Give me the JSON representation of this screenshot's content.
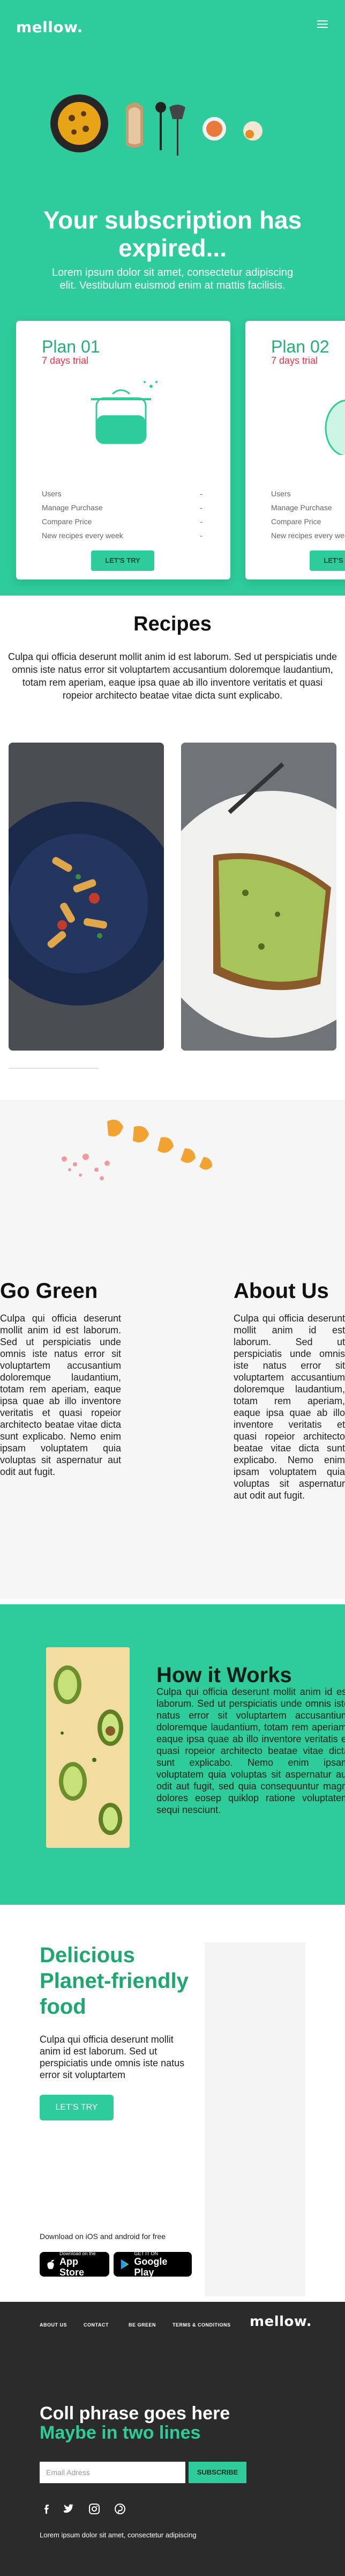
{
  "header": {
    "logo": "mellow."
  },
  "hero": {
    "title": "Your subscription has expired...",
    "subtitle": "Lorem ipsum dolor sit amet, consectetur adipiscing elit. Vestibulum euismod enim at mattis facilisis."
  },
  "plans": [
    {
      "title": "Plan 01",
      "trial": "7 days trial",
      "features": [
        {
          "label": "Users",
          "value": "-"
        },
        {
          "label": "Manage Purchase",
          "value": "-"
        },
        {
          "label": "Compare Price",
          "value": "-"
        },
        {
          "label": "New recipes every week",
          "value": "-"
        }
      ],
      "button": "LET'S TRY"
    },
    {
      "title": "Plan 02",
      "trial": "7 days trial",
      "features": [
        {
          "label": "Users",
          "value": ""
        },
        {
          "label": "Manage Purchase",
          "value": ""
        },
        {
          "label": "Compare Price",
          "value": ""
        },
        {
          "label": "New recipes every week",
          "value": ""
        }
      ],
      "button": "LET'S TRY"
    }
  ],
  "recipes": {
    "title": "Recipes",
    "text": "Culpa qui officia deserunt mollit anim id est laborum. Sed ut perspiciatis unde omnis iste natus error sit voluptartem accusantium doloremque laudantium, totam rem aperiam, eaque ipsa quae ab illo inventore veritatis et quasi ropeior architecto beatae vitae dicta sunt explicabo."
  },
  "go_green": {
    "title": "Go Green",
    "text": "Culpa qui officia deserunt mollit anim id est laborum. Sed ut perspiciatis unde omnis iste natus error sit voluptartem accusantium doloremque laudantium, totam rem aperiam, eaque ipsa quae ab illo inventore veritatis et quasi ropeior architecto beatae vitae dicta sunt explicabo. Nemo enim ipsam voluptatem quia voluptas sit aspernatur aut odit aut fugit."
  },
  "about": {
    "title": "About Us",
    "text": "Culpa qui officia deserunt mollit anim id est laborum. Sed ut perspiciatis unde omnis iste natus error sit voluptartem accusantium doloremque laudantium, totam rem aperiam, eaque ipsa quae ab illo inventore veritatis et quasi ropeior architecto beatae vitae dicta sunt explicabo. Nemo enim ipsam voluptatem quia voluptas sit aspernatur aut odit aut fugit."
  },
  "how": {
    "title": "How it Works",
    "text": "Culpa qui officia deserunt mollit anim id est laborum. Sed ut perspiciatis unde omnis iste natus error sit voluptartem accusantium doloremque laudantium, totam rem aperiam, eaque ipsa quae ab illo inventore veritatis et quasi ropeior architecto beatae vitae dicta sunt explicabo. Nemo enim ipsam voluptatem quia voluptas sit aspernatur aut odit aut fugit, sed quia consequuntur magni dolores eosep quiklop ratione voluptatem sequi nesciunt."
  },
  "delicious": {
    "title": "Delicious Planet-friendly food",
    "text": "Culpa qui officia deserunt mollit anim id est laborum. Sed ut perspiciatis unde omnis iste natus error sit voluptartem",
    "button": "LET'S TRY",
    "download_text": "Download on iOS and android for free",
    "app_store_small": "Download on the",
    "app_store_big": "App Store",
    "google_small": "GET IT ON",
    "google_big": "Google Play"
  },
  "footer": {
    "links": [
      "ABOUT US",
      "CONTACT",
      "BE GREEN",
      "TERMS & CONDITIONS"
    ],
    "logo": "mellow.",
    "title_line1": "Coll phrase goes here",
    "title_line2": "Maybe in two lines",
    "email_placeholder": "Email Adress",
    "subscribe": "SUBSCRIBE",
    "note": "Lorem ipsum dolor sit amet, consectetur adipiscing"
  },
  "colors": {
    "accent": "#2ecc9a",
    "accent_dark": "#1ea76f",
    "alert": "#e8354b",
    "footer_bg": "#2b2b2b"
  }
}
